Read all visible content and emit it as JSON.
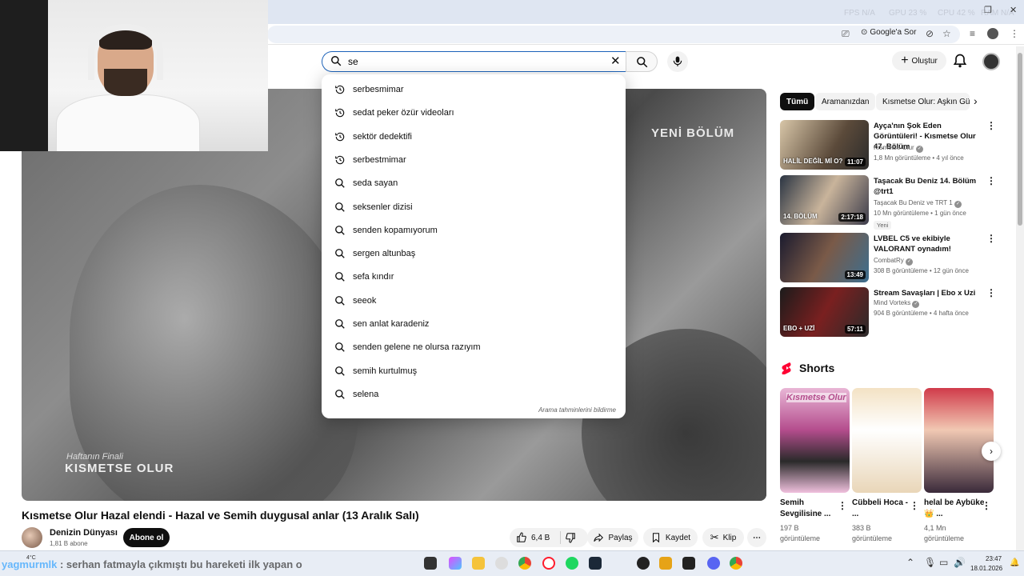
{
  "browser": {
    "stats": {
      "fps": "FPS N/A",
      "gpu": "GPU 23 %",
      "cpu": "CPU 42 %",
      "ram": "RAM N/A"
    },
    "ask_google": "Google'a Sor"
  },
  "header": {
    "search_value": "se",
    "create_label": "Oluştur"
  },
  "suggestions": [
    {
      "text": "serbesmimar",
      "type": "history"
    },
    {
      "text": "sedat peker özür videoları",
      "type": "history"
    },
    {
      "text": "sektör dedektifi",
      "type": "history"
    },
    {
      "text": "serbestmimar",
      "type": "history"
    },
    {
      "text": "seda sayan",
      "type": "search"
    },
    {
      "text": "seksenler dizisi",
      "type": "search"
    },
    {
      "text": "senden kopamıyorum",
      "type": "search"
    },
    {
      "text": "sergen altunbaş",
      "type": "search"
    },
    {
      "text": "sefa kındır",
      "type": "search"
    },
    {
      "text": "seeok",
      "type": "search"
    },
    {
      "text": "sen anlat karadeniz",
      "type": "search"
    },
    {
      "text": "senden gelene ne olursa razıyım",
      "type": "search"
    },
    {
      "text": "semih kurtulmuş",
      "type": "search"
    },
    {
      "text": "selena",
      "type": "search"
    }
  ],
  "suggest_footer": "Arama tahminlerini bildirme",
  "player": {
    "overlay_new": "YENİ BÖLÜM",
    "overlay_finale": "Haftanın Finali",
    "overlay_show": "KISMETSE OLUR"
  },
  "video": {
    "title": "Kısmetse Olur Hazal elendi - Hazal ve Semih duygusal anlar (13 Aralık Salı)",
    "channel": "Denizin Dünyası",
    "subscribers": "1,81 B abone",
    "subscribe_label": "Abone ol",
    "likes": "6,4 B",
    "share_label": "Paylaş",
    "save_label": "Kaydet",
    "clip_label": "Klip"
  },
  "sidebar": {
    "chips": [
      "Tümü",
      "Aramanızdan",
      "Kısmetse Olur: Aşkın Gü"
    ],
    "recommendations": [
      {
        "title": "Ayça'nın Şok Eden Görüntüleri! - Kısmetse Olur 47. Bölüm",
        "channel": "Kısmetse Olur",
        "meta": "1,8 Mn görüntüleme • 4 yıl önce",
        "duration": "11:07",
        "thumb_text": "HALİL DEĞİL Mİ O?"
      },
      {
        "title": "Taşacak Bu Deniz 14. Bölüm @trt1",
        "channel": "Taşacak Bu Deniz ve TRT 1",
        "meta": "10 Mn görüntüleme • 1 gün önce",
        "duration": "2:17:18",
        "thumb_text": "14. BÖLÜM",
        "badge": "Yeni"
      },
      {
        "title": "LVBEL C5 ve ekibiyle VALORANT oynadım!",
        "channel": "CombatRy",
        "meta": "308 B görüntüleme • 12 gün önce",
        "duration": "13:49"
      },
      {
        "title": "Stream Savaşları | Ebo x Uzi",
        "channel": "Mind Vorteks",
        "meta": "904 B görüntüleme • 4 hafta önce",
        "duration": "57:11",
        "thumb_text": "EBO + UZİ"
      }
    ],
    "shorts_title": "Shorts",
    "shorts": [
      {
        "title": "Semih Sevgilisine ...",
        "views": "197 B görüntüleme",
        "thumb_text": "Kısmetse Olur"
      },
      {
        "title": "Cübbeli Hoca - ...",
        "views": "383 B görüntüleme"
      },
      {
        "title": "helal be Aybüke 👑 ...",
        "views": "4,1 Mn görüntüleme"
      }
    ]
  },
  "taskbar": {
    "temp": "4°C",
    "chat_user": "yagmurmlk",
    "chat_text": " : serhan fatmayla çıkmıştı bu hareketi ilk yapan o",
    "time": "23:47",
    "date": "18.01.2026"
  },
  "colors": {
    "accent": "#1c62b9",
    "shorts_red": "#ff0033",
    "chat_blue": "#3ba6ff"
  }
}
